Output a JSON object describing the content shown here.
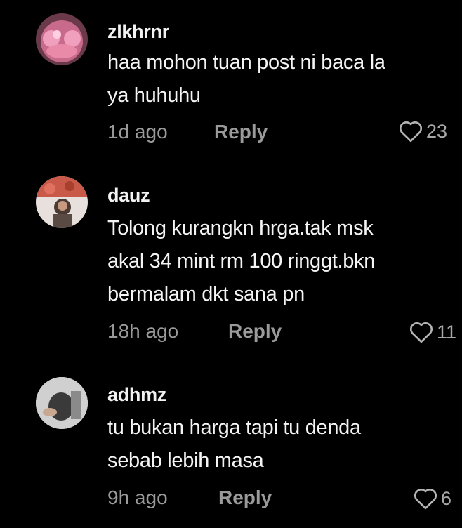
{
  "comments": [
    {
      "username": "zlkhrnr",
      "text_lines": [
        "haa mohon tuan post ni baca la",
        "ya huhuhu"
      ],
      "time": "1d ago",
      "reply_label": "Reply",
      "likes": "23",
      "avatar_color": "#e07a9a"
    },
    {
      "username": "dauz",
      "text_lines": [
        "Tolong kurangkn hrga.tak msk",
        "akal 34 mint rm 100 ringgt.bkn",
        "bermalam dkt sana pn"
      ],
      "time": "18h ago",
      "reply_label": "Reply",
      "likes": "11",
      "avatar_color": "#d9a09a"
    },
    {
      "username": "adhmz",
      "text_lines": [
        "tu bukan harga tapi tu denda",
        "sebab lebih masa"
      ],
      "time": "9h ago",
      "reply_label": "Reply",
      "likes": "6",
      "avatar_color": "#9a9a9a"
    }
  ],
  "colors": {
    "background": "#000000",
    "username": "#f2f2f2",
    "text": "#f4f4f4",
    "meta": "#9a9a9a"
  },
  "icons": {
    "like": "heart-outline-icon"
  }
}
